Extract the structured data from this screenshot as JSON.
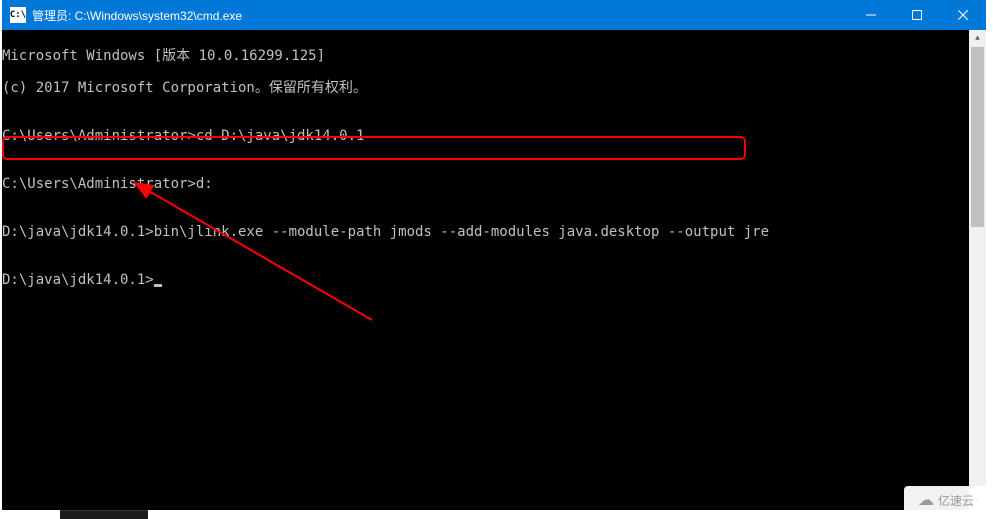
{
  "window": {
    "title": "管理员: C:\\Windows\\system32\\cmd.exe",
    "icon_label": "C:\\"
  },
  "terminal": {
    "lines": [
      "Microsoft Windows [版本 10.0.16299.125]",
      "(c) 2017 Microsoft Corporation。保留所有权利。",
      "",
      "C:\\Users\\Administrator>cd D:\\java\\jdk14.0.1",
      "",
      "C:\\Users\\Administrator>d:",
      "",
      "D:\\java\\jdk14.0.1>bin\\jlink.exe --module-path jmods --add-modules java.desktop --output jre",
      "",
      "D:\\java\\jdk14.0.1>"
    ]
  },
  "taskbar": {
    "fragment": ""
  },
  "watermark": {
    "text": "亿速云"
  }
}
